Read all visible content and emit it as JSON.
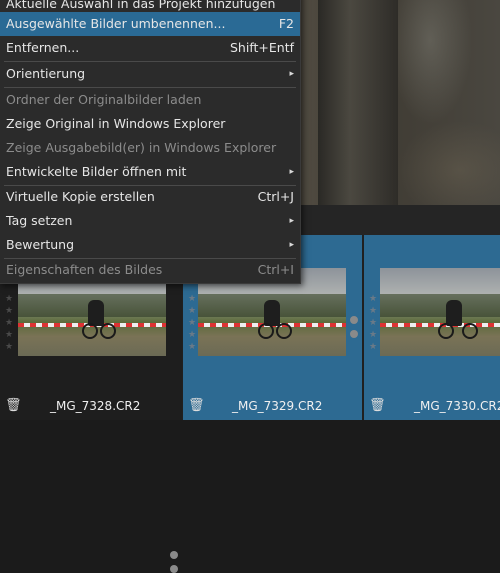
{
  "menu": {
    "items": [
      {
        "label": "Aktuelle Auswahl in das Projekt hinzufügen",
        "shortcut": "",
        "submenu": false,
        "disabled": false,
        "highlighted": false
      },
      {
        "label": "Ausgewählte Bilder umbenennen...",
        "shortcut": "F2",
        "submenu": false,
        "disabled": false,
        "highlighted": true
      },
      {
        "label": "Entfernen...",
        "shortcut": "Shift+Entf",
        "submenu": false,
        "disabled": false,
        "highlighted": false
      },
      {
        "label": "Orientierung",
        "shortcut": "",
        "submenu": true,
        "disabled": false,
        "highlighted": false
      },
      {
        "label": "Ordner der Originalbilder laden",
        "shortcut": "",
        "submenu": false,
        "disabled": true,
        "highlighted": false
      },
      {
        "label": "Zeige Original in Windows Explorer",
        "shortcut": "",
        "submenu": false,
        "disabled": false,
        "highlighted": false
      },
      {
        "label": "Zeige Ausgabebild(er) in Windows Explorer",
        "shortcut": "",
        "submenu": false,
        "disabled": true,
        "highlighted": false
      },
      {
        "label": "Entwickelte Bilder öffnen mit",
        "shortcut": "",
        "submenu": true,
        "disabled": false,
        "highlighted": false
      },
      {
        "label": "Virtuelle Kopie erstellen",
        "shortcut": "Ctrl+J",
        "submenu": false,
        "disabled": false,
        "highlighted": false
      },
      {
        "label": "Tag setzen",
        "shortcut": "",
        "submenu": true,
        "disabled": false,
        "highlighted": false
      },
      {
        "label": "Bewertung",
        "shortcut": "",
        "submenu": true,
        "disabled": false,
        "highlighted": false
      },
      {
        "label": "Eigenschaften des Bildes",
        "shortcut": "Ctrl+I",
        "submenu": false,
        "disabled": true,
        "highlighted": false
      }
    ],
    "submenu_arrow": "▸"
  },
  "thumbnails": [
    {
      "filename": "_MG_7328.CR2",
      "selected": false
    },
    {
      "filename": "_MG_7329.CR2",
      "selected": true
    },
    {
      "filename": "_MG_7330.CR2",
      "selected": true
    }
  ],
  "icons": {
    "star": "★",
    "trash": "🗑",
    "trash_icon": "trash-icon",
    "star_icon": "star-icon"
  },
  "colors": {
    "highlight": "#2a6a95",
    "selected_thumb": "#2d6a92",
    "menu_bg": "#2b2b2b"
  }
}
